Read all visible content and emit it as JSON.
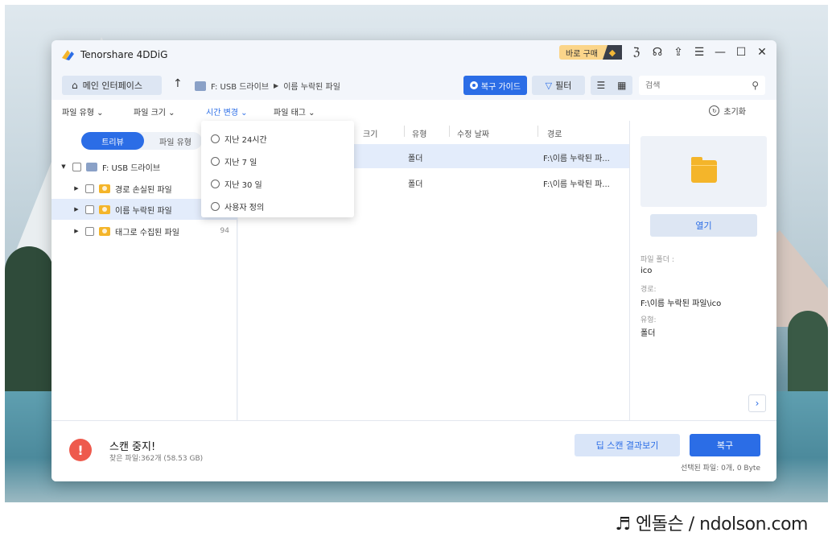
{
  "app": {
    "title": "Tenorshare 4DDiG"
  },
  "titlebar": {
    "buy_label": "바로 구매",
    "buy_icon": "diamond-icon",
    "icons": [
      "pin-icon",
      "headset-icon",
      "share-icon",
      "menu-icon",
      "minimize-icon",
      "maximize-icon",
      "close-icon"
    ]
  },
  "nav": {
    "home_label": "메인 인터페이스",
    "breadcrumb": [
      "F: USB 드라이브",
      "이름 누락된 파일"
    ],
    "guide_label": "복구 가이드",
    "filter_label": "필터",
    "search_placeholder": "검색"
  },
  "filters": {
    "file_type": "파일 유형",
    "file_size": "파일 크기",
    "time_change": "시간 변경",
    "file_tag": "파일 태그",
    "reset": "초기화"
  },
  "dropdown": {
    "options": [
      "지난 24시간",
      "지난 7 일",
      "지난 30 일",
      "사용자 정의"
    ]
  },
  "left": {
    "tab_tree": "트리뷰",
    "tab_type": "파일 유형",
    "tree": [
      {
        "label": "F: USB 드라이브",
        "count": ""
      },
      {
        "label": "경로 손실된 파일",
        "count": ""
      },
      {
        "label": "이름 누락된 파일",
        "count": ""
      },
      {
        "label": "태그로 수집된 파일",
        "count": "94"
      }
    ]
  },
  "table": {
    "columns": [
      "크기",
      "유형",
      "수정 날짜",
      "경로"
    ],
    "rows": [
      {
        "type": "폴더",
        "path": "F:\\이름 누락된 파..."
      },
      {
        "type": "폴더",
        "path": "F:\\이름 누락된 파..."
      }
    ]
  },
  "details": {
    "open_label": "열기",
    "folder_label": "파일 폴더 :",
    "folder_value": "ico",
    "path_label": "경로:",
    "path_value": "F:\\이름 누락된 파일\\ico",
    "type_label": "유형:",
    "type_value": "폴더"
  },
  "bottom": {
    "status_title": "스캔 중지!",
    "status_sub": "찾은 파일:362개 (58.53 GB)",
    "deep_scan_label": "딥 스캔 결과보기",
    "recover_label": "복구",
    "selected_info": "선택된 파일: 0개, 0 Byte"
  },
  "watermark": "♬ 엔돌슨 / ndolson.com",
  "colors": {
    "accent": "#2b6de6",
    "folder": "#f4b52a",
    "danger": "#ee5a4d"
  }
}
